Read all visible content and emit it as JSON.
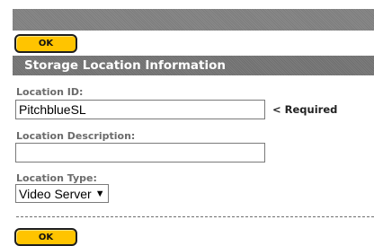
{
  "toolbar": {
    "ok_label": "OK"
  },
  "section": {
    "title": "Storage Location Information"
  },
  "form": {
    "location_id": {
      "label": "Location ID:",
      "value": "PitchblueSL",
      "note": "< Required"
    },
    "location_description": {
      "label": "Location Description:",
      "value": ""
    },
    "location_type": {
      "label": "Location Type:",
      "selected": "Video Server"
    }
  },
  "footer": {
    "ok_label": "OK"
  }
}
